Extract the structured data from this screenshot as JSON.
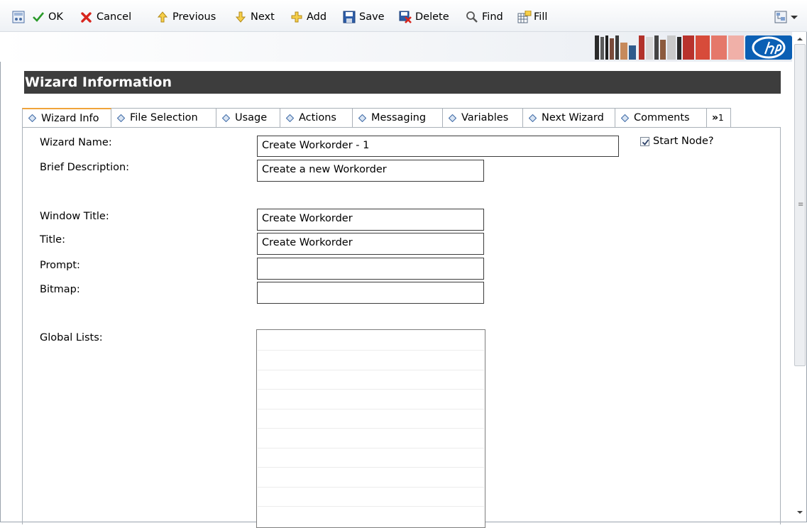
{
  "toolbar": {
    "ok_label": "OK",
    "cancel_label": "Cancel",
    "previous_label": "Previous",
    "next_label": "Next",
    "add_label": "Add",
    "save_label": "Save",
    "delete_label": "Delete",
    "find_label": "Find",
    "fill_label": "Fill"
  },
  "section": {
    "title": "Wizard Information"
  },
  "tabs": [
    {
      "label": "Wizard Info",
      "active": true
    },
    {
      "label": "File Selection"
    },
    {
      "label": "Usage"
    },
    {
      "label": "Actions"
    },
    {
      "label": "Messaging"
    },
    {
      "label": "Variables"
    },
    {
      "label": "Next Wizard"
    },
    {
      "label": "Comments"
    }
  ],
  "tabs_overflow": {
    "chevron": "»",
    "count": "1"
  },
  "form": {
    "wizard_name": {
      "label": "Wizard Name:",
      "value": "Create Workorder - 1"
    },
    "brief_description": {
      "label": "Brief Description:",
      "value": "Create a new Workorder"
    },
    "window_title": {
      "label": "Window Title:",
      "value": "Create Workorder"
    },
    "title": {
      "label": "Title:",
      "value": "Create Workorder"
    },
    "prompt": {
      "label": "Prompt:",
      "value": ""
    },
    "bitmap": {
      "label": "Bitmap:",
      "value": ""
    },
    "global_lists": {
      "label": "Global Lists:",
      "items": []
    },
    "start_node": {
      "label": "Start Node?",
      "checked": true
    }
  },
  "colors": {
    "header_bg": "#3d3d3d",
    "active_tab_accent": "#f0a43a",
    "hp_blue": "#0a5fb4",
    "cancel_red": "#d8261e",
    "ok_green": "#2a9a2a"
  }
}
